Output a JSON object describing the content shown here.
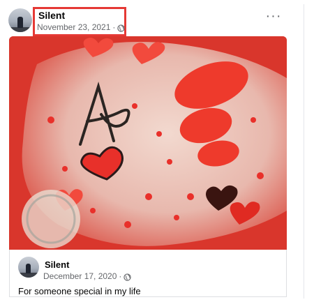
{
  "post": {
    "author": "Silent",
    "date": "November 23, 2021",
    "separator": "·",
    "privacy_icon": "globe-icon",
    "more_icon": "more-options-icon",
    "more_glyph": "···",
    "highlight_color": "#e53935"
  },
  "shared_post": {
    "author": "Silent",
    "date": "December 17, 2020",
    "separator": "·",
    "privacy_icon": "globe-icon",
    "caption": "For someone special in my life"
  },
  "colors": {
    "meta_text": "#65676b",
    "primary_text": "#050505"
  }
}
